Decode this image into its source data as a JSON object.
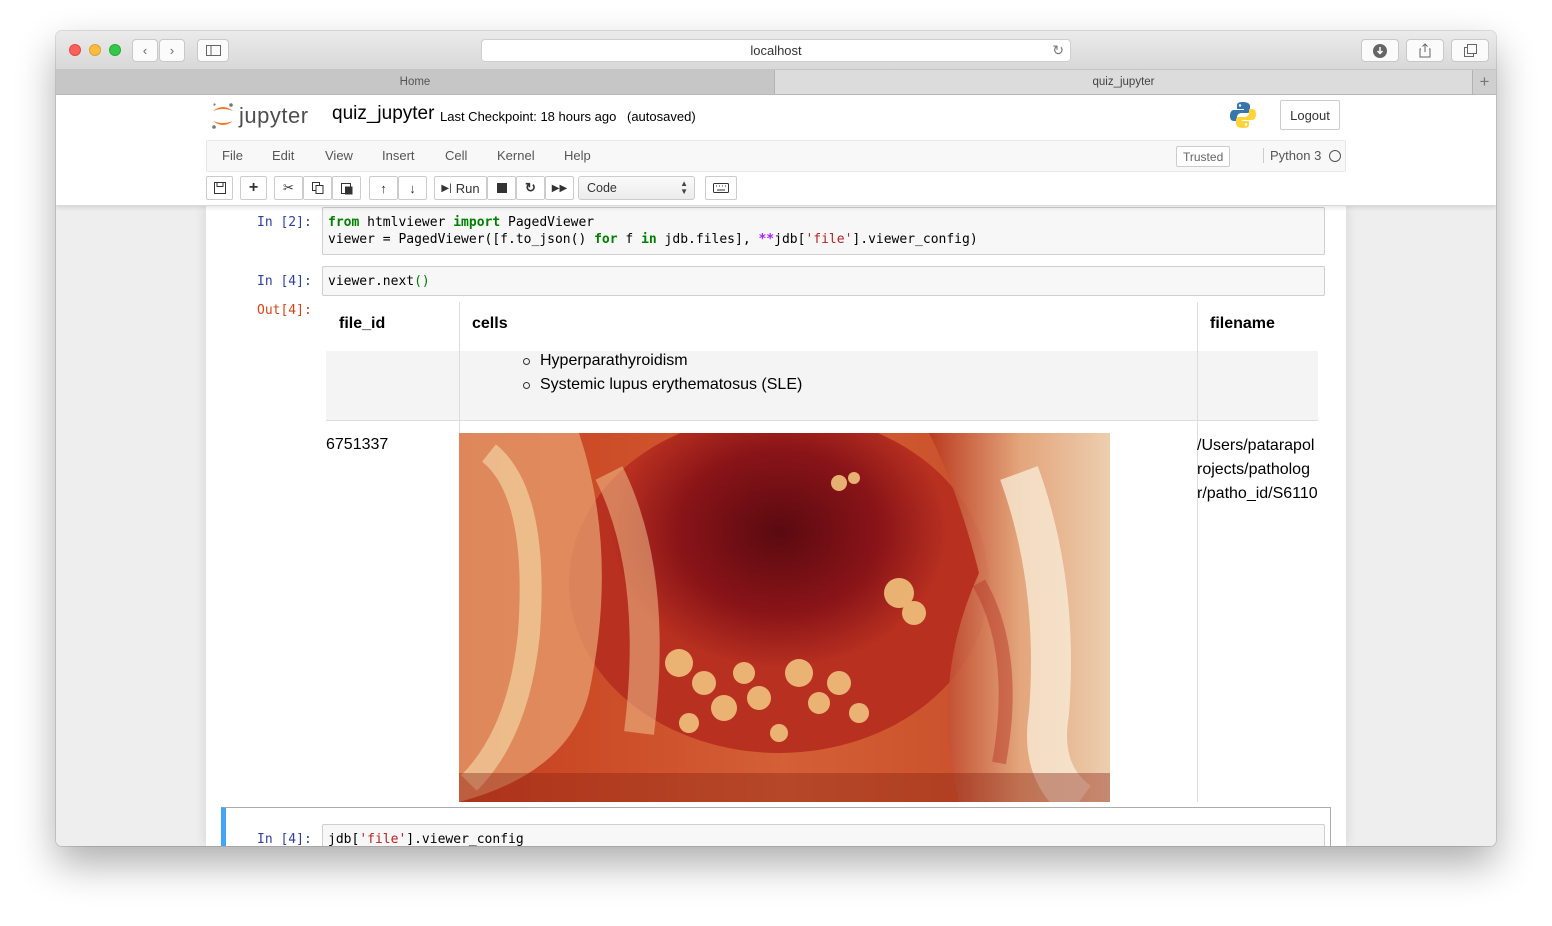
{
  "browser": {
    "url": "localhost",
    "tabs": [
      {
        "label": "Home",
        "active": false
      },
      {
        "label": "quiz_jupyter",
        "active": true
      }
    ]
  },
  "header": {
    "logo_text": "jupyter",
    "notebook_name": "quiz_jupyter",
    "checkpoint": "Last Checkpoint: 18 hours ago",
    "autosave": "(autosaved)",
    "logout_label": "Logout"
  },
  "menubar": {
    "items": [
      "File",
      "Edit",
      "View",
      "Insert",
      "Cell",
      "Kernel",
      "Help"
    ],
    "trusted_label": "Trusted",
    "kernel_name": "Python 3"
  },
  "toolbar": {
    "run_label": "Run",
    "cell_type": "Code"
  },
  "cells": [
    {
      "prompt": "In [2]:",
      "code_line1": "from htmlviewer import PagedViewer",
      "code_line2": "viewer = PagedViewer([f.to_json() for f in jdb.files], **jdb['file'].viewer_config)"
    },
    {
      "prompt": "In [4]:",
      "code_line1": "viewer.next()",
      "out_prompt": "Out[4]:"
    },
    {
      "prompt": "In [4]:",
      "code_line1": "jdb['file'].viewer_config"
    }
  ],
  "output_table": {
    "columns": [
      "file_id",
      "cells",
      "filename"
    ],
    "prev_row_bullets": [
      "Hyperparathyroidism",
      "Systemic lupus erythematosus (SLE)"
    ],
    "row": {
      "file_id": "6751337",
      "filename_lines": [
        "/Users/patarapol",
        "rojects/patholog",
        "r/patho_id/S6110"
      ]
    }
  },
  "colors": {
    "accent": "#42a5f5",
    "prompt_in": "#303f9f",
    "prompt_out": "#d84315",
    "keyword": "#008000",
    "string": "#ba2121"
  }
}
